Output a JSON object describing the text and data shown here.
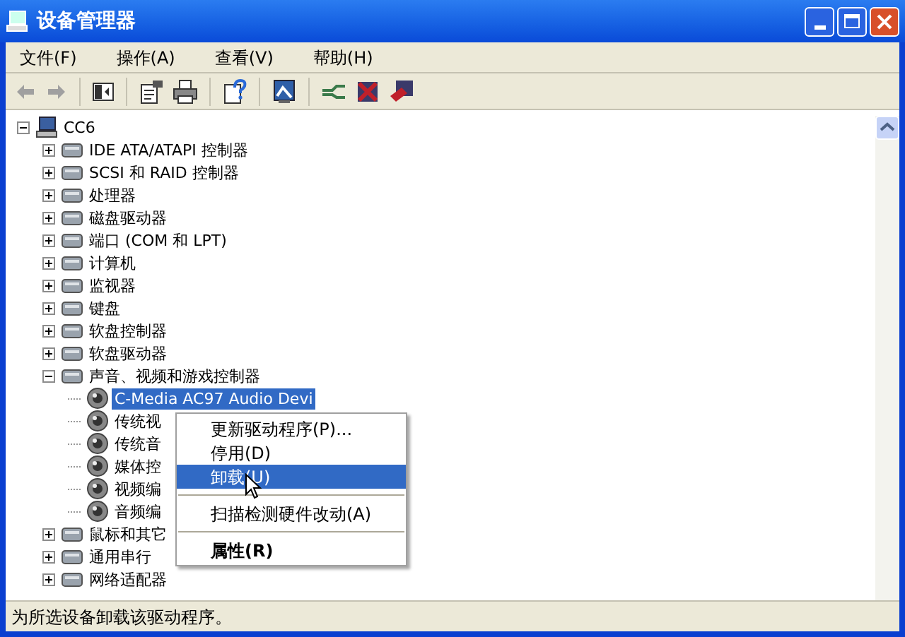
{
  "window": {
    "title": "设备管理器"
  },
  "menu_bar": [
    "文件(F)",
    "操作(A)",
    "查看(V)",
    "帮助(H)"
  ],
  "toolbar": [
    {
      "kind": "back",
      "disabled": true
    },
    {
      "kind": "forward",
      "disabled": true
    },
    {
      "kind": "sep"
    },
    {
      "kind": "tree"
    },
    {
      "kind": "sep"
    },
    {
      "kind": "properties"
    },
    {
      "kind": "print"
    },
    {
      "kind": "sep"
    },
    {
      "kind": "help"
    },
    {
      "kind": "sep"
    },
    {
      "kind": "scan"
    },
    {
      "kind": "sep"
    },
    {
      "kind": "update"
    },
    {
      "kind": "disable"
    },
    {
      "kind": "uninstall"
    }
  ],
  "tree": {
    "label": "CC6",
    "expanded": true,
    "children": [
      {
        "label": "IDE ATA/ATAPI 控制器",
        "expanded": false
      },
      {
        "label": "SCSI 和 RAID 控制器",
        "expanded": false
      },
      {
        "label": "处理器",
        "expanded": false
      },
      {
        "label": "磁盘驱动器",
        "expanded": false
      },
      {
        "label": "端口 (COM 和 LPT)",
        "expanded": false
      },
      {
        "label": "计算机",
        "expanded": false
      },
      {
        "label": "监视器",
        "expanded": false
      },
      {
        "label": "键盘",
        "expanded": false
      },
      {
        "label": "软盘控制器",
        "expanded": false
      },
      {
        "label": "软盘驱动器",
        "expanded": false
      },
      {
        "label": "声音、视频和游戏控制器",
        "expanded": true,
        "children": [
          {
            "label": "C-Media AC97 Audio Devi",
            "selected": true
          },
          {
            "label": "传统视",
            "selected": false
          },
          {
            "label": "传统音",
            "selected": false
          },
          {
            "label": "媒体控",
            "selected": false
          },
          {
            "label": "视频编",
            "selected": false
          },
          {
            "label": "音频编",
            "selected": false
          }
        ]
      },
      {
        "label": "鼠标和其它",
        "expanded": false
      },
      {
        "label": "通用串行",
        "expanded": false
      },
      {
        "label": "网络适配器",
        "expanded": false
      }
    ]
  },
  "context_menu": [
    {
      "kind": "item",
      "label": "更新驱动程序(P)...",
      "selected": false,
      "bold": false
    },
    {
      "kind": "item",
      "label": "停用(D)",
      "selected": false,
      "bold": false
    },
    {
      "kind": "item",
      "label": "卸载(U)",
      "selected": true,
      "bold": false
    },
    {
      "kind": "separator"
    },
    {
      "kind": "item",
      "label": "扫描检测硬件改动(A)",
      "selected": false,
      "bold": false
    },
    {
      "kind": "separator"
    },
    {
      "kind": "item",
      "label": "属性(R)",
      "selected": false,
      "bold": true
    }
  ],
  "status_bar": "为所选设备卸载该驱动程序。"
}
